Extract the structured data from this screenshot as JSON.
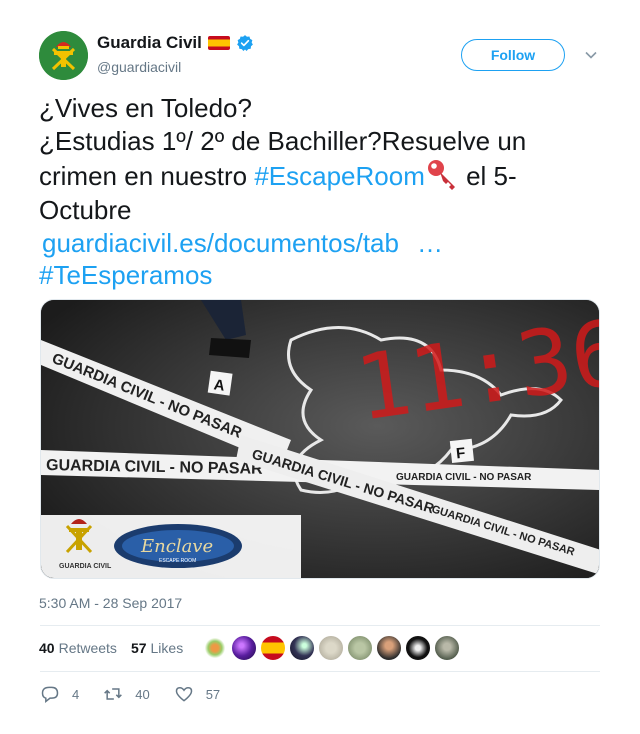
{
  "account": {
    "name": "Guardia Civil",
    "handle": "@guardiacivil",
    "follow_label": "Follow"
  },
  "tweet": {
    "lines": {
      "l1": "¿Vives en Toledo?",
      "l2": "¿Estudias 1º/ 2º de Bachiller?Resuelve un",
      "l3a": "crimen en nuestro ",
      "l3_hashtag": "#EscapeRoom",
      "l3b": " el 5-",
      "l4": "Octubre",
      "l5_link": "guardiacivil.es/documentos/tab",
      "l5_ellipsis": "…",
      "l6_hashtag": "#TeEsperamos"
    },
    "timestamp": "5:30 AM - 28 Sep 2017"
  },
  "media": {
    "tape_text": "GUARDIA CIVIL - NO PASAR",
    "timer": "11:36",
    "marker_a": "A",
    "marker_f": "F",
    "logo_label": "GUARDIA CIVIL",
    "enclave_label": "Enclave",
    "enclave_sub": "ESCAPE ROOM"
  },
  "stats": {
    "retweets_count": "40",
    "retweets_label": "Retweets",
    "likes_count": "57",
    "likes_label": "Likes"
  },
  "actions": {
    "reply_count": "4",
    "retweet_count": "40",
    "like_count": "57"
  },
  "colors": {
    "brand_blue": "#1da1f2",
    "secondary_text": "#657786",
    "avatar_green": "#2e8b3c"
  }
}
